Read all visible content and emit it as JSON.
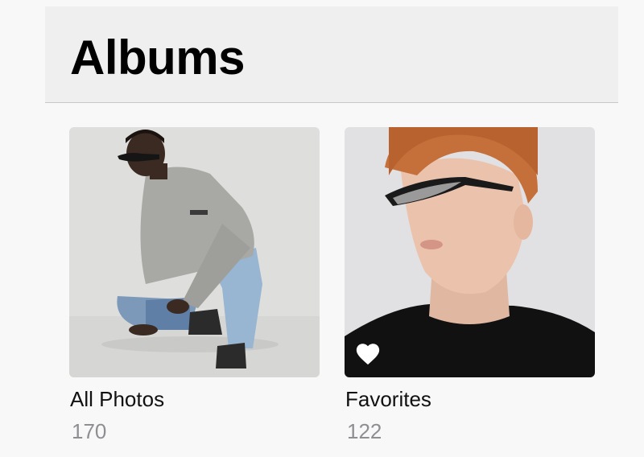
{
  "header": {
    "title": "Albums"
  },
  "albums": [
    {
      "name": "All Photos",
      "count": "170",
      "thumbnail": "man-crouching-in-sunglasses-photo"
    },
    {
      "name": "Favorites",
      "count": "122",
      "thumbnail": "red-haired-man-in-sunglasses-photo",
      "badge_icon": "heart-icon"
    }
  ],
  "colors": {
    "background": "#f8f8f8",
    "header_background": "#efeff0",
    "title": "#000000",
    "count_text": "#8e8e93"
  }
}
